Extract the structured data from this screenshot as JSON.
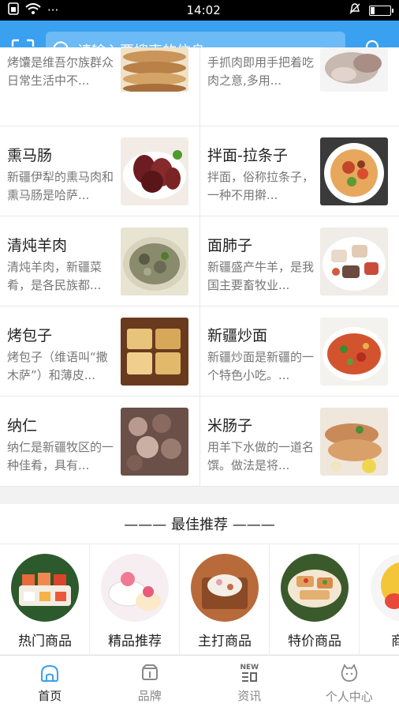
{
  "status": {
    "time": "14:02",
    "dots": "···"
  },
  "header": {
    "search_placeholder": "请输入要搜索的信息"
  },
  "items": [
    {
      "title": "",
      "desc": "烤馕是维吾尔族群众日常生活中不..."
    },
    {
      "title": "",
      "desc": "手抓肉即用手把着吃肉之意,多用..."
    },
    {
      "title": "熏马肠",
      "desc": "新疆伊犁的熏马肉和熏马肠是哈萨..."
    },
    {
      "title": "拌面-拉条子",
      "desc": "拌面，俗称拉条子，一种不用擀..."
    },
    {
      "title": "清炖羊肉",
      "desc": "清炖羊肉，新疆菜肴，是各民族都..."
    },
    {
      "title": "面肺子",
      "desc": "新疆盛产牛羊，是我国主要畜牧业..."
    },
    {
      "title": "烤包子",
      "desc": "烤包子（维语叫“撒木萨”）和薄皮..."
    },
    {
      "title": "新疆炒面",
      "desc": "新疆炒面是新疆的一个特色小吃。..."
    },
    {
      "title": "纳仁",
      "desc": "纳仁是新疆牧区的一种佳肴，具有..."
    },
    {
      "title": "米肠子",
      "desc": "用羊下水做的一道名馔。做法是将..."
    }
  ],
  "best": {
    "label": "——— 最佳推荐 ———"
  },
  "categories": [
    {
      "label": "热门商品"
    },
    {
      "label": "精品推荐"
    },
    {
      "label": "主打商品"
    },
    {
      "label": "特价商品"
    },
    {
      "label": "商家"
    }
  ],
  "tabs": [
    {
      "label": "首页",
      "icon": "home-icon"
    },
    {
      "label": "品牌",
      "icon": "brand-icon"
    },
    {
      "label": "资讯",
      "icon": "news-icon"
    },
    {
      "label": "个人中心",
      "icon": "profile-icon"
    }
  ],
  "tab_news_badge": "NEW",
  "colors": {
    "primary": "#3aa0f0",
    "search_bg": "#6cbaf6"
  }
}
